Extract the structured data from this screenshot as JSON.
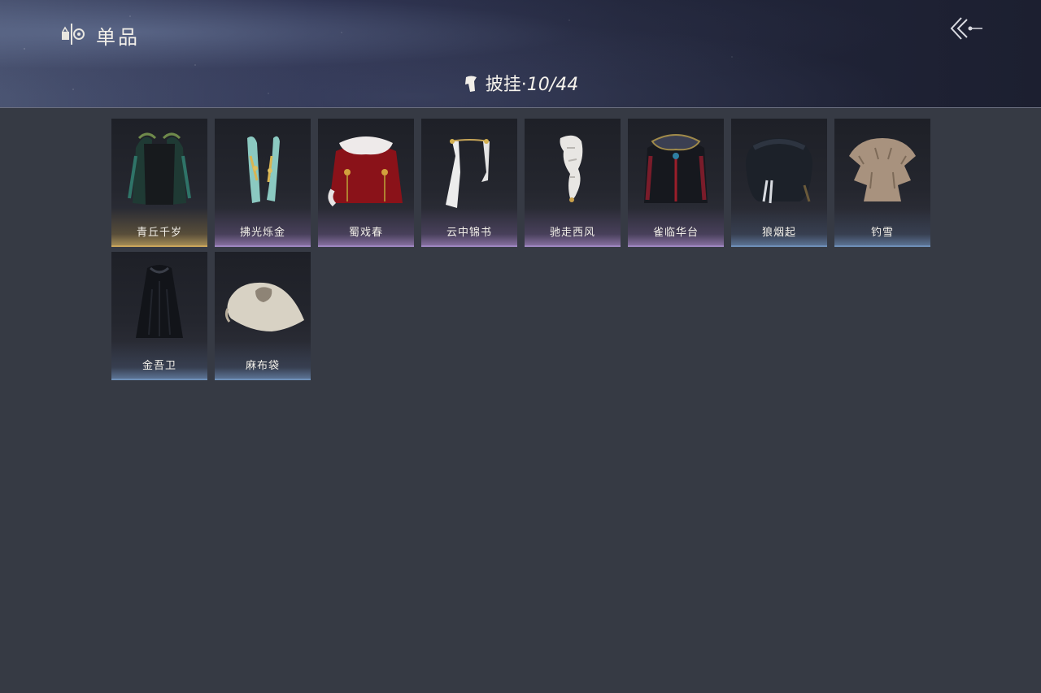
{
  "header": {
    "title": "单品",
    "logo_icon": "inventory-emblem-icon",
    "back_icon": "back-arrow-icon"
  },
  "category": {
    "icon": "cape-icon",
    "name": "披挂",
    "separator": "·",
    "count": "10/44"
  },
  "items": [
    {
      "name": "青丘千岁",
      "rarity": "gold"
    },
    {
      "name": "拂光烁金",
      "rarity": "purple"
    },
    {
      "name": "蜀戏春",
      "rarity": "purple"
    },
    {
      "name": "云中锦书",
      "rarity": "purple"
    },
    {
      "name": "驰走西风",
      "rarity": "purple"
    },
    {
      "name": "雀临华台",
      "rarity": "purple"
    },
    {
      "name": "狼烟起",
      "rarity": "blue"
    },
    {
      "name": "钓雪",
      "rarity": "blue"
    },
    {
      "name": "金吾卫",
      "rarity": "blue"
    },
    {
      "name": "麻布袋",
      "rarity": "blue"
    }
  ],
  "colors": {
    "background": "#363a44",
    "gold": "#c9a55b",
    "purple": "#9d86c0",
    "blue": "#6e8fb8"
  }
}
